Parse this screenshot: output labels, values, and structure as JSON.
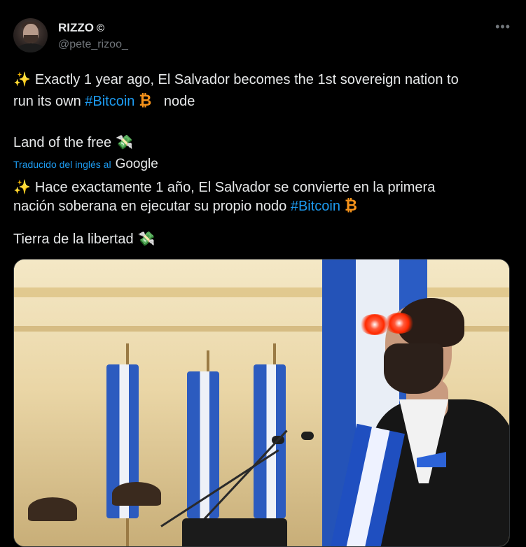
{
  "tweet": {
    "display_name": "RIZZO",
    "verified_icon": "©",
    "handle": "@pete_rizoo_",
    "more_icon": "•••",
    "line1_text": "Exactly 1 year ago, El Salvador becomes the 1st sovereign nation to",
    "line2_prefix": "run its own ",
    "hashtag": "#Bitcoin",
    "line2_suffix": "node",
    "line3_text": "Land of the free",
    "translated_label": "Traducido del inglés al",
    "google_label": "Google",
    "trans_line1": "Hace exactamente 1 año, El Salvador se convierte en la primera",
    "trans_line2_prefix": "nación soberana en ejecutar su propio nodo ",
    "trans_hashtag": "#Bitcoin",
    "trans_line3": "Tierra de la libertad"
  },
  "icons": {
    "sparkle": "✨",
    "bitcoin": "₿",
    "money": "💸"
  },
  "colors": {
    "background": "#000000",
    "text": "#e7e9ea",
    "muted": "#71767b",
    "link": "#1d9bf0",
    "bitcoin": "#f7931a"
  }
}
